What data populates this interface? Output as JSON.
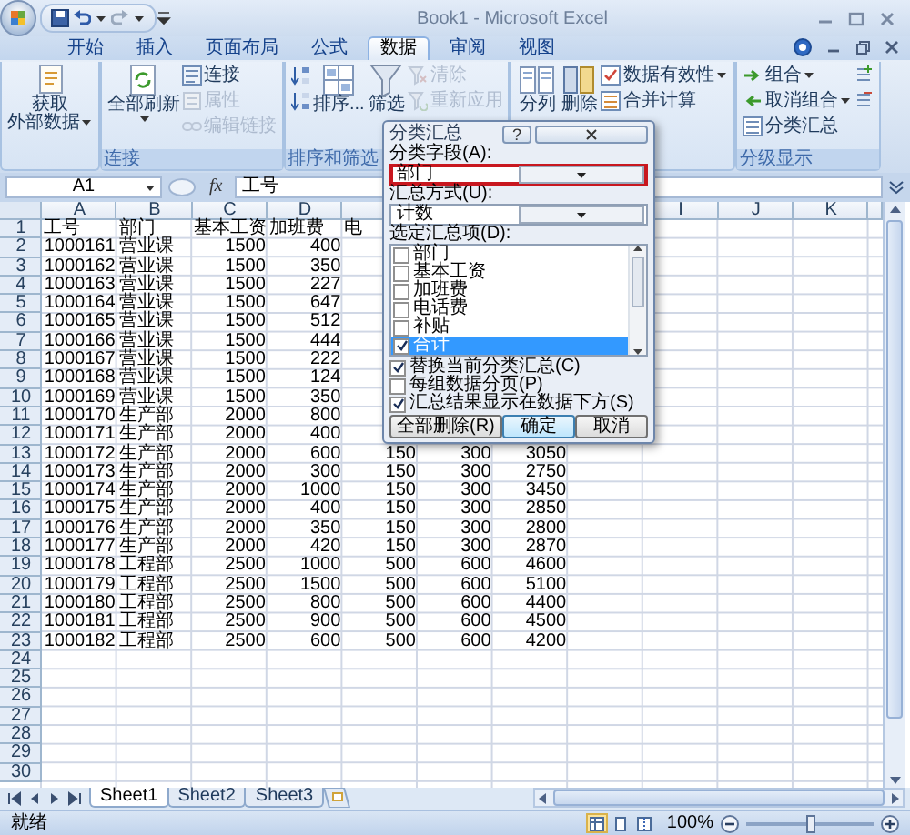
{
  "title_bar": {
    "title": "Book1 - Microsoft Excel"
  },
  "ribbon_tabs": [
    {
      "label": "开始",
      "selected": false
    },
    {
      "label": "插入",
      "selected": false
    },
    {
      "label": "页面布局",
      "selected": false
    },
    {
      "label": "公式",
      "selected": false
    },
    {
      "label": "数据",
      "selected": true
    },
    {
      "label": "审阅",
      "selected": false
    },
    {
      "label": "视图",
      "selected": false
    }
  ],
  "ribbon_groups": [
    {
      "columns": [
        [
          {
            "kind": "large",
            "lines": [
              "获取",
              "外部数据"
            ],
            "dropdown": true,
            "disabled": false
          }
        ]
      ]
    },
    {
      "label": "连接",
      "columns": [
        [
          {
            "kind": "large",
            "lines": [
              "全部刷新"
            ],
            "dropdown": true,
            "disabled": false
          }
        ],
        [
          {
            "kind": "small",
            "label": "连接",
            "dropdown": false,
            "disabled": false
          },
          {
            "kind": "small",
            "label": "属性",
            "dropdown": false,
            "disabled": true
          },
          {
            "kind": "small",
            "label": "编辑链接",
            "dropdown": false,
            "disabled": true
          }
        ]
      ]
    },
    {
      "label": "排序和筛选",
      "columns": [
        [
          {
            "kind": "icon",
            "dropdown": false,
            "disabled": false
          },
          {
            "kind": "icon",
            "dropdown": false,
            "disabled": false
          }
        ],
        [
          {
            "kind": "large",
            "lines": [
              "排序..."
            ],
            "dropdown": false,
            "disabled": false
          }
        ],
        [
          {
            "kind": "large",
            "lines": [
              "筛选"
            ],
            "dropdown": false,
            "disabled": false
          }
        ],
        [
          {
            "kind": "small",
            "label": "清除",
            "dropdown": false,
            "disabled": true
          },
          {
            "kind": "small",
            "label": "重新应用",
            "dropdown": false,
            "disabled": true
          }
        ]
      ]
    },
    {
      "columns": [
        [
          {
            "kind": "large",
            "lines": [
              "分列"
            ],
            "dropdown": false,
            "disabled": false
          }
        ],
        [
          {
            "kind": "large",
            "lines": [
              "删除"
            ],
            "dropdown": false,
            "disabled": false
          }
        ],
        [
          {
            "kind": "small",
            "label": "数据有效性",
            "dropdown": true,
            "disabled": false
          },
          {
            "kind": "small",
            "label": "合并计算",
            "dropdown": false,
            "disabled": false
          }
        ]
      ]
    },
    {
      "label": "分级显示",
      "columns": [
        [
          {
            "kind": "small",
            "label": "组合",
            "dropdown": true,
            "disabled": false
          },
          {
            "kind": "small",
            "label": "取消组合",
            "dropdown": true,
            "disabled": false
          },
          {
            "kind": "small",
            "label": "分类汇总",
            "dropdown": false,
            "disabled": false
          }
        ],
        [
          {
            "kind": "icon",
            "dropdown": false,
            "disabled": false
          },
          {
            "kind": "icon",
            "dropdown": false,
            "disabled": false
          }
        ]
      ]
    }
  ],
  "formula_bar": {
    "name_box": "A1",
    "function_label": "fx",
    "content": "工号"
  },
  "column_headers_left": [
    "A",
    "B",
    "C",
    "D"
  ],
  "column_headers_right": [
    "I",
    "J",
    "K"
  ],
  "rows": [
    {
      "number": "1",
      "kind": "header",
      "cells": [
        "工号",
        "部门",
        "基本工资",
        "加班费",
        "电"
      ]
    },
    {
      "number": "2",
      "kind": "data",
      "cells": [
        "1000161",
        "营业课",
        "1500",
        "400"
      ]
    },
    {
      "number": "3",
      "kind": "data",
      "cells": [
        "1000162",
        "营业课",
        "1500",
        "350"
      ]
    },
    {
      "number": "4",
      "kind": "data",
      "cells": [
        "1000163",
        "营业课",
        "1500",
        "227"
      ]
    },
    {
      "number": "5",
      "kind": "data",
      "cells": [
        "1000164",
        "营业课",
        "1500",
        "647"
      ]
    },
    {
      "number": "6",
      "kind": "data",
      "cells": [
        "1000165",
        "营业课",
        "1500",
        "512"
      ]
    },
    {
      "number": "7",
      "kind": "data",
      "cells": [
        "1000166",
        "营业课",
        "1500",
        "444"
      ]
    },
    {
      "number": "8",
      "kind": "data",
      "cells": [
        "1000167",
        "营业课",
        "1500",
        "222"
      ]
    },
    {
      "number": "9",
      "kind": "data",
      "cells": [
        "1000168",
        "营业课",
        "1500",
        "124"
      ]
    },
    {
      "number": "10",
      "kind": "data",
      "cells": [
        "1000169",
        "营业课",
        "1500",
        "350"
      ]
    },
    {
      "number": "11",
      "kind": "data",
      "cells": [
        "1000170",
        "生产部",
        "2000",
        "800"
      ]
    },
    {
      "number": "12",
      "kind": "data",
      "cells": [
        "1000171",
        "生产部",
        "2000",
        "400"
      ]
    },
    {
      "number": "13",
      "kind": "data",
      "cells": [
        "1000172",
        "生产部",
        "2000",
        "600",
        "150",
        "300",
        "3050"
      ]
    },
    {
      "number": "14",
      "kind": "data",
      "cells": [
        "1000173",
        "生产部",
        "2000",
        "300",
        "150",
        "300",
        "2750"
      ]
    },
    {
      "number": "15",
      "kind": "data",
      "cells": [
        "1000174",
        "生产部",
        "2000",
        "1000",
        "150",
        "300",
        "3450"
      ]
    },
    {
      "number": "16",
      "kind": "data",
      "cells": [
        "1000175",
        "生产部",
        "2000",
        "400",
        "150",
        "300",
        "2850"
      ]
    },
    {
      "number": "17",
      "kind": "data",
      "cells": [
        "1000176",
        "生产部",
        "2000",
        "350",
        "150",
        "300",
        "2800"
      ]
    },
    {
      "number": "18",
      "kind": "data",
      "cells": [
        "1000177",
        "生产部",
        "2000",
        "420",
        "150",
        "300",
        "2870"
      ]
    },
    {
      "number": "19",
      "kind": "data",
      "cells": [
        "1000178",
        "工程部",
        "2500",
        "1000",
        "500",
        "600",
        "4600"
      ]
    },
    {
      "number": "20",
      "kind": "data",
      "cells": [
        "1000179",
        "工程部",
        "2500",
        "1500",
        "500",
        "600",
        "5100"
      ]
    },
    {
      "number": "21",
      "kind": "data",
      "cells": [
        "1000180",
        "工程部",
        "2500",
        "800",
        "500",
        "600",
        "4400"
      ]
    },
    {
      "number": "22",
      "kind": "data",
      "cells": [
        "1000181",
        "工程部",
        "2500",
        "900",
        "500",
        "600",
        "4500"
      ]
    },
    {
      "number": "23",
      "kind": "data",
      "cells": [
        "1000182",
        "工程部",
        "2500",
        "600",
        "500",
        "600",
        "4200"
      ]
    },
    {
      "number": "24",
      "kind": "data"
    },
    {
      "number": "25",
      "kind": "data"
    },
    {
      "number": "26",
      "kind": "data"
    },
    {
      "number": "27",
      "kind": "data"
    },
    {
      "number": "28",
      "kind": "data"
    },
    {
      "number": "29",
      "kind": "data"
    },
    {
      "number": "30",
      "kind": "data"
    }
  ],
  "sheet_tabs": [
    {
      "label": "Sheet1",
      "selected": true
    },
    {
      "label": "Sheet2",
      "selected": false
    },
    {
      "label": "Sheet3",
      "selected": false
    }
  ],
  "status_bar": {
    "text": "就绪",
    "views": [
      {
        "selected": true
      },
      {
        "selected": false
      },
      {
        "selected": false
      }
    ],
    "zoom": {
      "reading": "100%",
      "level": 0.5
    }
  },
  "dialog": {
    "title": "分类汇总",
    "help_button": "?",
    "fields": [
      {
        "label": "分类字段(A):",
        "value": "部门",
        "highlighted": true
      },
      {
        "label": "汇总方式(U):",
        "value": "计数",
        "highlighted": false
      }
    ],
    "list_label": "选定汇总项(D):",
    "list_items": [
      {
        "label": "部门",
        "checked": false,
        "selected": false
      },
      {
        "label": "基本工资",
        "checked": false,
        "selected": false
      },
      {
        "label": "加班费",
        "checked": false,
        "selected": false
      },
      {
        "label": "电话费",
        "checked": false,
        "selected": false
      },
      {
        "label": "补贴",
        "checked": false,
        "selected": false
      },
      {
        "label": "合计",
        "checked": true,
        "selected": true
      }
    ],
    "options": [
      {
        "label": "替换当前分类汇总(C)",
        "checked": true
      },
      {
        "label": "每组数据分页(P)",
        "checked": false
      },
      {
        "label": "汇总结果显示在数据下方(S)",
        "checked": true
      }
    ],
    "buttons": [
      {
        "label": "全部删除(R)",
        "default": false
      },
      {
        "label": "确定",
        "default": true
      },
      {
        "label": "取消",
        "default": false
      }
    ]
  }
}
